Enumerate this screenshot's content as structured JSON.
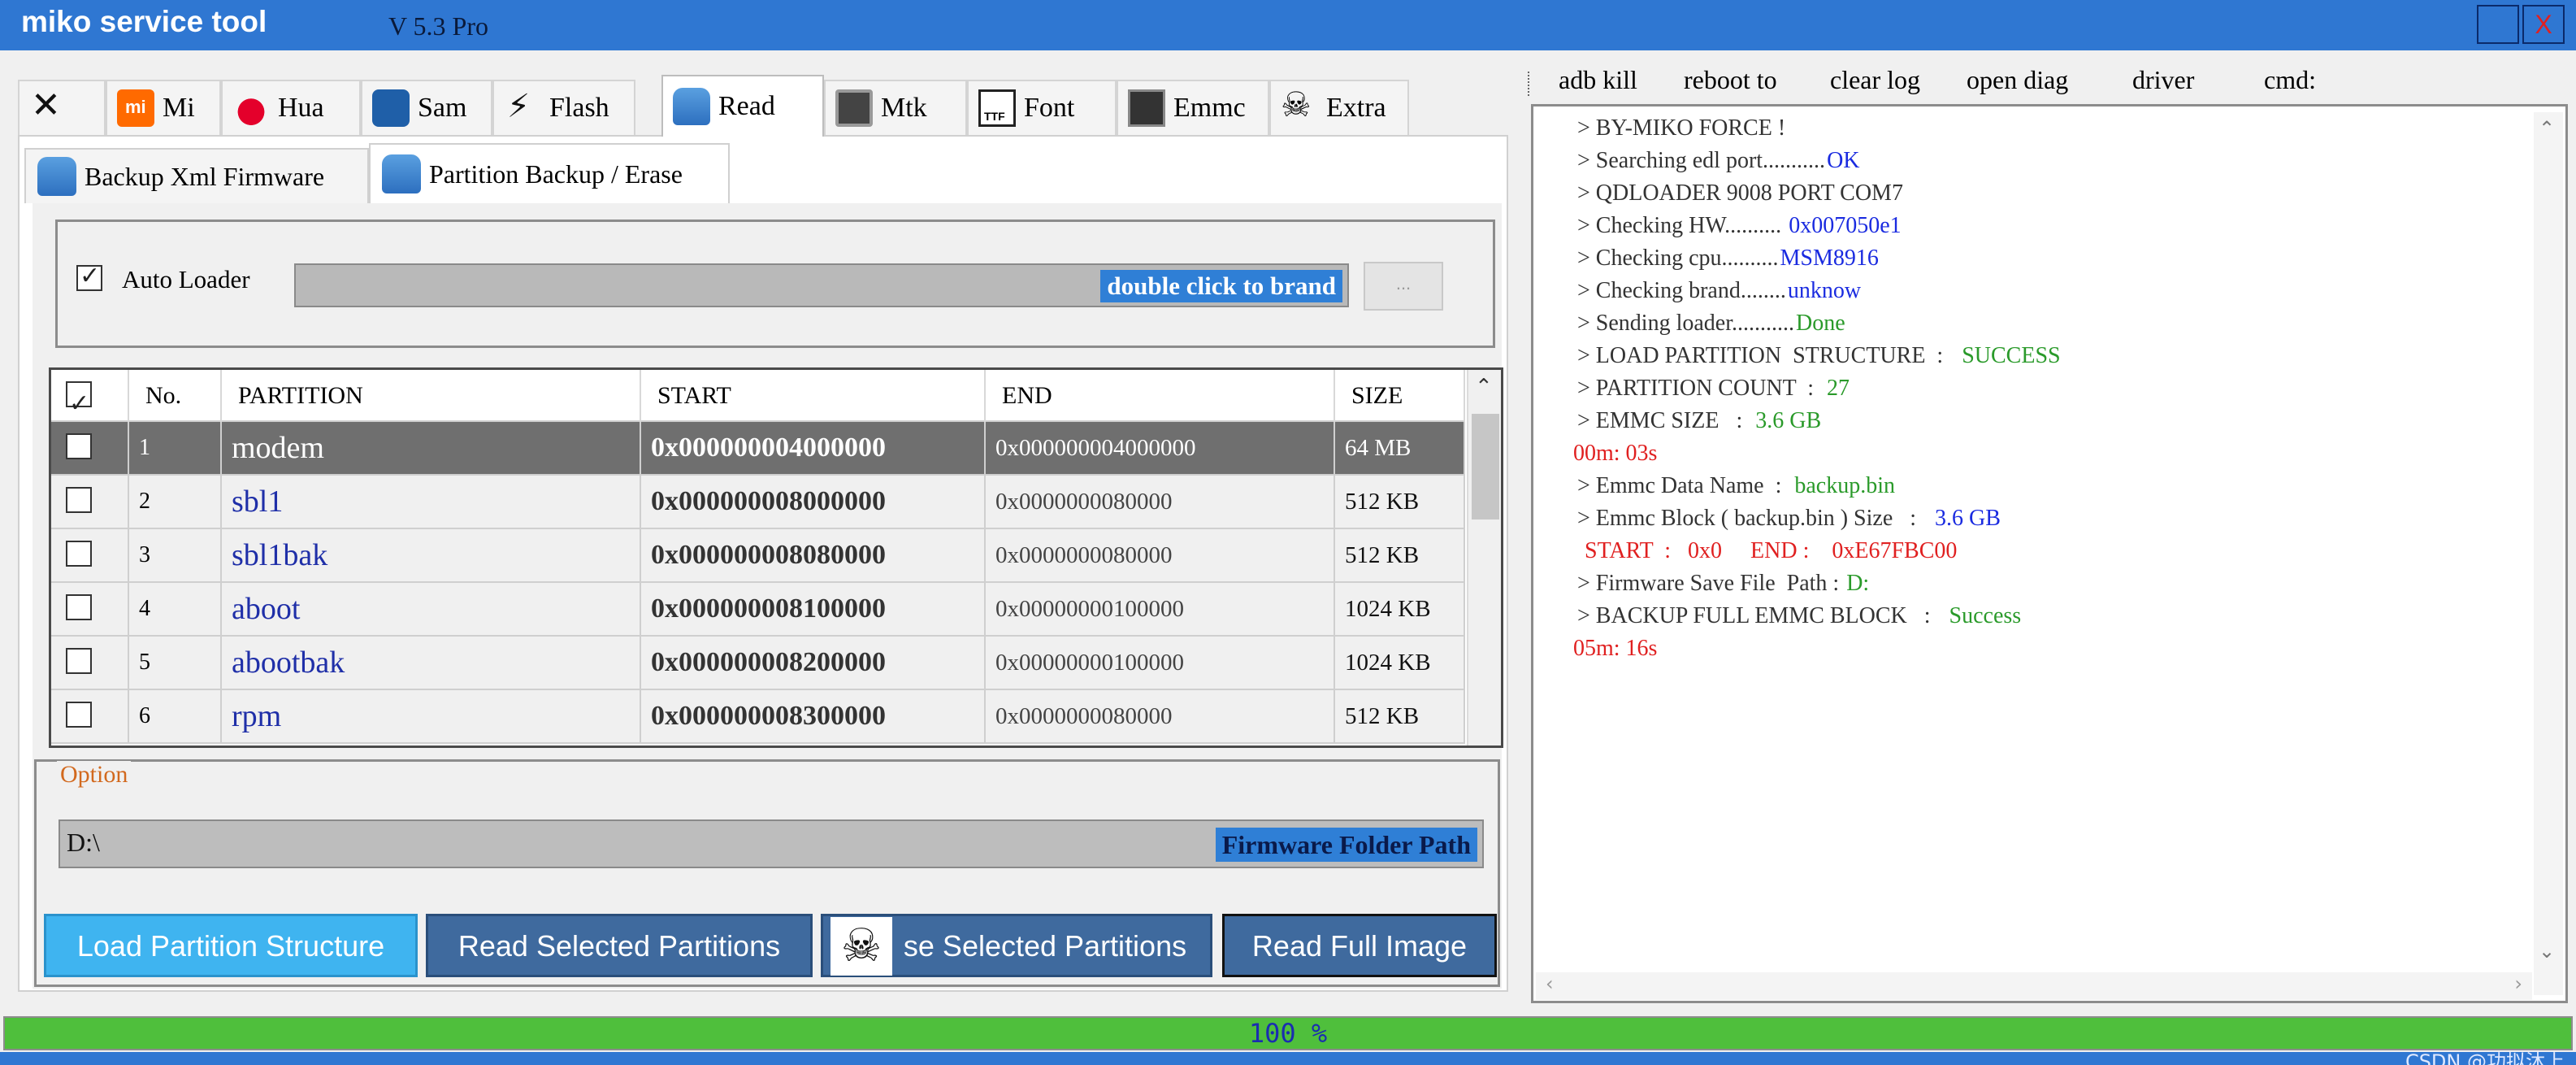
{
  "app": {
    "title": "miko service tool",
    "version": "V 5.3 Pro",
    "close_label": "X"
  },
  "tabs": [
    {
      "label": "",
      "icon": "tools-icon"
    },
    {
      "label": "Mi",
      "icon": "mi-logo-icon"
    },
    {
      "label": "Hua",
      "icon": "huawei-logo-icon"
    },
    {
      "label": "Sam",
      "icon": "samsung-logo-icon"
    },
    {
      "label": "Flash",
      "icon": "lightning-icon"
    },
    {
      "label": "Read",
      "icon": "database-icon"
    },
    {
      "label": "Mtk",
      "icon": "chip-icon"
    },
    {
      "label": "Font",
      "icon": "ttf-font-icon"
    },
    {
      "label": "Emmc",
      "icon": "emmc-icon"
    },
    {
      "label": "Extra",
      "icon": "skull-icon"
    }
  ],
  "active_tab": "Read",
  "subtabs": [
    {
      "label": "Backup Xml Firmware",
      "icon": "database-icon"
    },
    {
      "label": "Partition Backup / Erase",
      "icon": "database-icon"
    }
  ],
  "loader": {
    "checkbox_label": "Auto Loader",
    "checked": true,
    "brand_hint": "double click to brand",
    "browse_label": "..."
  },
  "table": {
    "columns": [
      "No.",
      "PARTITION",
      "START",
      "END",
      "SIZE"
    ],
    "rows": [
      {
        "no": "1",
        "partition": "modem",
        "start": "0x000000004000000",
        "end": "0x000000004000000",
        "size": "64 MB"
      },
      {
        "no": "2",
        "partition": "sbl1",
        "start": "0x000000008000000",
        "end": "0x0000000080000",
        "size": "512 KB"
      },
      {
        "no": "3",
        "partition": "sbl1bak",
        "start": "0x000000008080000",
        "end": "0x0000000080000",
        "size": "512 KB"
      },
      {
        "no": "4",
        "partition": "aboot",
        "start": "0x000000008100000",
        "end": "0x00000000100000",
        "size": "1024 KB"
      },
      {
        "no": "5",
        "partition": "abootbak",
        "start": "0x000000008200000",
        "end": "0x00000000100000",
        "size": "1024 KB"
      },
      {
        "no": "6",
        "partition": "rpm",
        "start": "0x000000008300000",
        "end": "0x0000000080000",
        "size": "512 KB"
      }
    ],
    "selected_row": 0
  },
  "option": {
    "legend": "Option",
    "path_value": "D:\\",
    "path_hint": "Firmware Folder Path",
    "buttons": {
      "load": "Load Partition Structure",
      "read_selected": "Read Selected Partitions",
      "erase_selected": "se Selected Partitions",
      "read_full": "Read Full Image"
    }
  },
  "right_menu": [
    "adb kill",
    "reboot to",
    "clear log",
    "open diag",
    "driver",
    "cmd:"
  ],
  "log": [
    {
      "prefix": " > BY-MIKO FORCE !",
      "value": "",
      "color": "#333333"
    },
    {
      "prefix": " > Searching edl port...........",
      "value": "OK",
      "color": "#1a2be0"
    },
    {
      "prefix": " > QDLOADER 9008 PORT COM7",
      "value": "",
      "color": "#333333"
    },
    {
      "prefix": " > Checking HW.......... ",
      "value": "0x007050e1",
      "color": "#1a2be0"
    },
    {
      "prefix": " > Checking cpu..........",
      "value": "MSM8916",
      "color": "#1a2be0"
    },
    {
      "prefix": " > Checking brand........",
      "value": "unknow",
      "color": "#1a2be0"
    },
    {
      "prefix": " > Sending loader...........",
      "value": "Done",
      "color": "#2a9a2a"
    },
    {
      "prefix": " > LOAD PARTITION  STRUCTURE  :   ",
      "value": "SUCCESS",
      "color": "#2a9a2a"
    },
    {
      "prefix": " > PARTITION COUNT  :  ",
      "value": "27",
      "color": "#2a9a2a"
    },
    {
      "prefix": " > EMMC SIZE   :  ",
      "value": "3.6 GB",
      "color": "#2a9a2a"
    },
    {
      "prefix": "",
      "value": "00m: 03s",
      "color": "#e02020"
    },
    {
      "prefix": " > Emmc Data Name  :  ",
      "value": "backup.bin",
      "color": "#2a9a2a"
    },
    {
      "prefix": " > Emmc Block ( backup.bin ) Size   :   ",
      "value": "3.6 GB",
      "color": "#1a2be0"
    },
    {
      "prefix": "",
      "value": "  START  :   0x0     END :    0xE67FBC00",
      "color": "#e02020"
    },
    {
      "prefix": " > Firmware Save File  Path : ",
      "value": "D:",
      "color": "#2a9a2a"
    },
    {
      "prefix": " > BACKUP FULL EMMC BLOCK   :   ",
      "value": "Success",
      "color": "#2a9a2a"
    },
    {
      "prefix": "",
      "value": "05m: 16s",
      "color": "#e02020"
    }
  ],
  "progress": {
    "value": 1.0,
    "text": "100 %",
    "fill_color": "#4fbf3c"
  },
  "watermark": "CSDN @功拟沐上"
}
